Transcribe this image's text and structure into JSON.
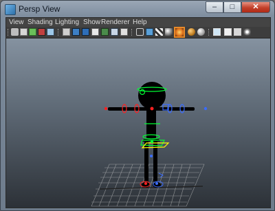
{
  "window": {
    "title": "Persp View",
    "minimize_glyph": "–",
    "maximize_glyph": "□",
    "close_glyph": "✕"
  },
  "menu": {
    "items": [
      "View",
      "Shading",
      "Lighting",
      "Show",
      "Renderer",
      "Help"
    ]
  },
  "toolbar": {
    "icons": [
      "camera-select-icon",
      "camera-attributes-icon",
      "bookmark-icon",
      "image-plane-icon",
      "grid-toggle-icon",
      "film-gate-icon",
      "resolution-gate-icon",
      "gate-mask-icon",
      "field-chart-icon",
      "safe-action-icon",
      "safe-title-icon",
      "wireframe-icon",
      "smooth-shade-icon",
      "wireframe-on-shaded-icon",
      "textured-icon",
      "use-all-lights-icon",
      "shadows-icon",
      "xray-icon",
      "isolate-select-icon",
      "xray-joints-icon",
      "xray-active-icon"
    ],
    "active_icon": "use-all-lights-icon",
    "accent": "#e88a2a"
  },
  "viewport": {
    "background_top": "#8592a0",
    "background_bottom": "#2c3137",
    "figure_color": "#000000",
    "ik_color": "#ffff00",
    "control_color": "#00ff33",
    "joint_color": "#3a6cff",
    "left_side_color": "#ff2020"
  }
}
